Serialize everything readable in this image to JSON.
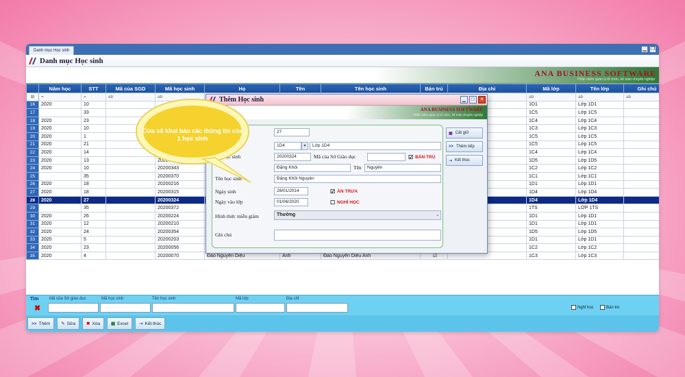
{
  "tab": {
    "label": "Danh mục Học sinh"
  },
  "window": {
    "title": "Danh mục Học sinh"
  },
  "brand": {
    "name": "ANA BUSINESS SOFTWARE",
    "tagline": "Phần mềm quản lý tổ chức, kế toán chuyên nghiệp"
  },
  "columns": [
    "Năm học",
    "STT",
    "Mã của SGD",
    "Mã học sinh",
    "Họ",
    "Tên",
    "Tên học sinh",
    "Bán trú",
    "Địa chỉ",
    "Mã lớp",
    "Tên lớp",
    "Ghi chú"
  ],
  "rows": [
    {
      "n": "16",
      "nam": "2020",
      "stt": "10",
      "ma": "",
      "ho": "",
      "ten": "",
      "ten_hs": "",
      "bt": "",
      "malop": "1D1",
      "tenlop": "Lớp 1D1"
    },
    {
      "n": "17",
      "nam": "",
      "stt": "33",
      "ma": "",
      "ho": "",
      "ten": "",
      "ten_hs": "",
      "bt": "",
      "malop": "1C5",
      "tenlop": "Lớp 1C5"
    },
    {
      "n": "18",
      "nam": "2020",
      "stt": "23",
      "ma": "",
      "ho": "",
      "ten": "",
      "ten_hs": "",
      "bt": "",
      "malop": "1C4",
      "tenlop": "Lớp 1C4"
    },
    {
      "n": "19",
      "nam": "2020",
      "stt": "10",
      "ma": "",
      "ho": "",
      "ten": "",
      "ten_hs": "",
      "bt": "",
      "malop": "1C3",
      "tenlop": "Lớp 1C3"
    },
    {
      "n": "20",
      "nam": "2020",
      "stt": "1",
      "ma": "",
      "ho": "",
      "ten": "",
      "ten_hs": "",
      "bt": "",
      "malop": "1C5",
      "tenlop": "Lớp 1C5"
    },
    {
      "n": "21",
      "nam": "2020",
      "stt": "21",
      "ma": "",
      "ho": "",
      "ten": "",
      "ten_hs": "",
      "bt": "",
      "malop": "1C5",
      "tenlop": "Lớp 1C5"
    },
    {
      "n": "22",
      "nam": "2020",
      "stt": "14",
      "ma": "",
      "ho": "",
      "ten": "",
      "ten_hs": "",
      "bt": "",
      "malop": "1C4",
      "tenlop": "Lớp 1C4"
    },
    {
      "n": "23",
      "nam": "2020",
      "stt": "13",
      "ma": "20200343",
      "ho": "Đ",
      "ten": "",
      "ten_hs": "",
      "bt": "",
      "malop": "1D5",
      "tenlop": "Lớp 1D5"
    },
    {
      "n": "24",
      "nam": "2020",
      "stt": "10",
      "ma": "20200343",
      "ho": "Đ",
      "ten": "",
      "ten_hs": "",
      "bt": "",
      "malop": "1C2",
      "tenlop": "Lớp 1C2"
    },
    {
      "n": "25",
      "nam": "",
      "stt": "35",
      "ma": "20200370",
      "ho": "Đ",
      "ten": "",
      "ten_hs": "",
      "bt": "",
      "malop": "1C1",
      "tenlop": "Lớp 1C1"
    },
    {
      "n": "26",
      "nam": "2020",
      "stt": "18",
      "ma": "20200216",
      "ho": "Đ",
      "ten": "",
      "ten_hs": "",
      "bt": "",
      "malop": "1D1",
      "tenlop": "Lớp 1D1"
    },
    {
      "n": "27",
      "nam": "2020",
      "stt": "18",
      "ma": "20200315",
      "ho": "Đ",
      "ten": "",
      "ten_hs": "",
      "bt": "",
      "malop": "1D4",
      "tenlop": "Lớp 1D4"
    },
    {
      "n": "28",
      "nam": "2020",
      "stt": "27",
      "ma": "20200324",
      "ho": "Đ",
      "ten": "",
      "ten_hs": "",
      "bt": "",
      "malop": "1D4",
      "tenlop": "Lớp 1D4",
      "selected": true
    },
    {
      "n": "29",
      "nam": "",
      "stt": "35",
      "ma": "20200372",
      "ho": "",
      "ten": "",
      "ten_hs": "",
      "bt": "",
      "malop": "1TS",
      "tenlop": "LỚP 1TS"
    },
    {
      "n": "30",
      "nam": "2020",
      "stt": "26",
      "ma": "20200224",
      "ho": "Đ",
      "ten": "",
      "ten_hs": "",
      "bt": "",
      "malop": "1D1",
      "tenlop": "Lớp 1D1"
    },
    {
      "n": "31",
      "nam": "2020",
      "stt": "12",
      "ma": "20200210",
      "ho": "Đ",
      "ten": "",
      "ten_hs": "",
      "bt": "",
      "malop": "1D1",
      "tenlop": "Lớp 1D1"
    },
    {
      "n": "32",
      "nam": "2020",
      "stt": "24",
      "ma": "20200354",
      "ho": "Đào Cù Minh",
      "ten": "Nguyên",
      "ten_hs": "Đào Cù Minh Nguyên",
      "bt": "☑",
      "malop": "1D5",
      "tenlop": "Lớp 1D5"
    },
    {
      "n": "33",
      "nam": "2020",
      "stt": "5",
      "ma": "20200203",
      "ho": "Đào Đức",
      "ten": "Bảo",
      "ten_hs": "Đào Đức Bảo",
      "bt": "☑",
      "malop": "1D1",
      "tenlop": "Lớp 1D1"
    },
    {
      "n": "34",
      "nam": "2020",
      "stt": "23",
      "ma": "20200056",
      "ho": "Đào Hoàng",
      "ten": "Nguyên",
      "ten_hs": "Đào Hoàng Nguyên",
      "bt": "☑",
      "malop": "1C2",
      "tenlop": "Lớp 1C2"
    },
    {
      "n": "35",
      "nam": "2020",
      "stt": "4",
      "ma": "20200070",
      "ho": "Đào Nguyễn Diệu",
      "ten": "Anh",
      "ten_hs": "Đào Nguyễn Diệu Anh",
      "bt": "☑",
      "malop": "1C3",
      "tenlop": "Lớp 1C3"
    }
  ],
  "search": {
    "title": "Tìm",
    "labels": [
      "Mã của Sở giáo dục",
      "Mã học sinh",
      "Tên học sinh",
      "Mã lớp",
      "Địa chỉ"
    ],
    "nghi_hoc": "Nghỉ học",
    "ban_tru": "Bán trú"
  },
  "toolbar": {
    "them": "Thêm",
    "sua": "Sửa",
    "xoa": "Xóa",
    "excel": "Excel",
    "ket_thuc": "Kết thúc"
  },
  "dialog": {
    "title": "Thêm Học sinh",
    "brand": "ANA BUSINESS SOFTWARE",
    "tagline": "Phần mềm quản lý tổ chức, kế toán chuyên nghiệp",
    "stt": "27",
    "ma_lop": "1D4",
    "ten_lop": "Lớp 1D4",
    "ma_hs_label": "Mã học sinh",
    "ma_hs": "20200324",
    "ma_sgd_label": "Mã của Sở Giáo dục",
    "ban_tru": "BÁN TRÚ",
    "ho": "Đặng Khôi",
    "ten_label": "Tên",
    "ten": "Nguyên",
    "ten_hs_label": "Tên học sinh",
    "ten_hs": "Đặng Khôi Nguyên",
    "ngay_sinh_label": "Ngày sinh",
    "ngay_sinh": "28/01/2014",
    "an_trua": "ĂN TRƯA",
    "ngay_vao_lop_label": "Ngày vào lớp",
    "ngay_vao_lop": "01/06/2020",
    "nghi_hoc": "NGHỈ HỌC",
    "mien_giam_label": "Hình thức miễn giảm",
    "mien_giam": "Thường",
    "ghi_chu_label": "Ghi chú",
    "btn_cat_giu": "Cất giữ",
    "btn_them_tiep": "Thêm tiếp",
    "btn_ket_thuc": "Kết thúc"
  },
  "callout": {
    "text": "Cửa sổ khai báo các thông tin của 1 học sinh"
  },
  "colors": {
    "header_blue": "#1a4f9c",
    "selected_row": "#0d2b86",
    "accent_red": "#d11",
    "search_bar": "#6fd1f1"
  }
}
